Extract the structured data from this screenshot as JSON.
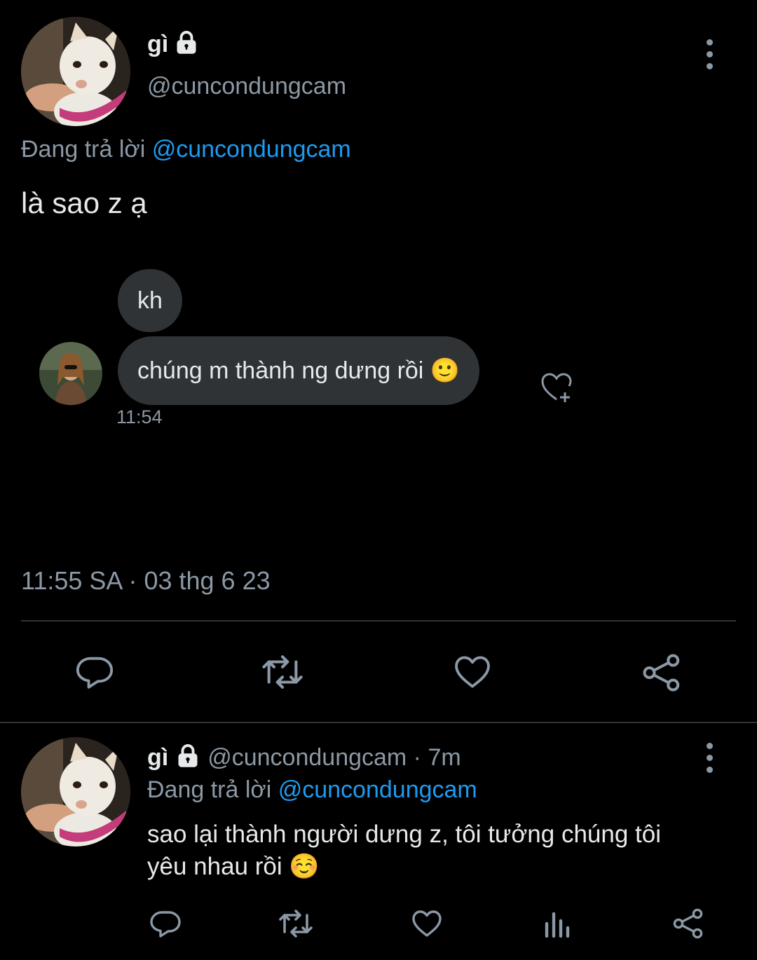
{
  "main_tweet": {
    "display_name": "gì",
    "handle": "@cuncondungcam",
    "replying_prefix": "Đang trả lời",
    "replying_to": "@cuncondungcam",
    "text": "là sao z ạ",
    "timestamp": "11:55 SA · 03 thg 6 23",
    "dm_image": {
      "message_1": "kh",
      "message_2": "chúng m thành ng dưng rồi 🙂",
      "time": "11:54"
    }
  },
  "reply_tweet": {
    "display_name": "gì",
    "handle": "@cuncondungcam · 7m",
    "replying_prefix": "Đang trả lời",
    "replying_to": "@cuncondungcam",
    "text_line1": "sao lại thành người dưng z, tôi tưởng chúng tôi",
    "text_line2": "yêu nhau rồi ☺️"
  },
  "icons": {
    "more": "more-vertical-icon",
    "lock": "lock-icon",
    "reply": "reply-icon",
    "retweet": "retweet-icon",
    "like": "like-icon",
    "share": "share-icon",
    "views": "views-icon",
    "react": "add-reaction-icon"
  },
  "colors": {
    "background": "#000000",
    "text": "#e7e9ea",
    "secondary": "#8b98a5",
    "link": "#1d9bf0",
    "bubble": "#2f3336"
  }
}
